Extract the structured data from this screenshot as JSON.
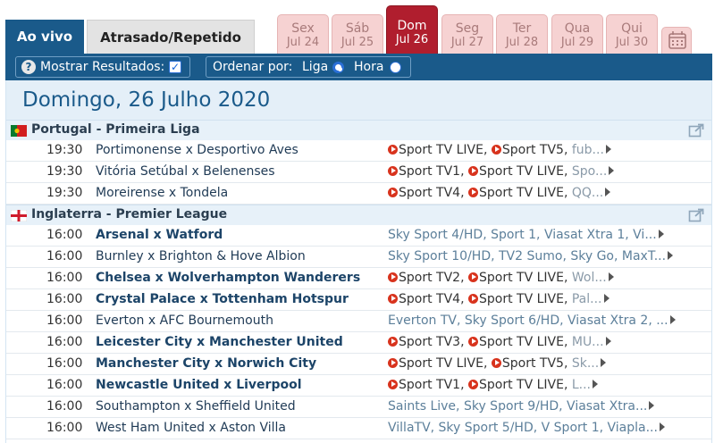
{
  "tabs": {
    "live": "Ao vivo",
    "delayed": "Atrasado/Repetido"
  },
  "days": [
    {
      "name": "Sex",
      "date": "Jul 24"
    },
    {
      "name": "Sáb",
      "date": "Jul 25"
    },
    {
      "name": "Dom",
      "date": "Jul 26"
    },
    {
      "name": "Seg",
      "date": "Jul 27"
    },
    {
      "name": "Ter",
      "date": "Jul 28"
    },
    {
      "name": "Qua",
      "date": "Jul 29"
    },
    {
      "name": "Qui",
      "date": "Jul 30"
    }
  ],
  "active_day": "Dom",
  "options": {
    "help": "?",
    "show_results": "Mostrar Resultados:",
    "order_by": "Ordenar por:",
    "order_league": "Liga",
    "order_time": "Hora"
  },
  "date_title": "Domingo, 26 Julho 2020",
  "leagues": [
    {
      "name": "Portugal - Primeira Liga",
      "matches": [
        {
          "time": "19:30",
          "teams": "Portimonense x Desportivo Aves",
          "bold": false,
          "live": [
            "Sport TV LIVE",
            "Sport TV5"
          ],
          "extra": "fub..."
        },
        {
          "time": "19:30",
          "teams": "Vitória Setúbal x Belenenses",
          "bold": false,
          "live": [
            "Sport TV1",
            "Sport TV LIVE"
          ],
          "extra": "Spo..."
        },
        {
          "time": "19:30",
          "teams": "Moreirense x Tondela",
          "bold": false,
          "live": [
            "Sport TV4",
            "Sport TV LIVE"
          ],
          "extra": "QQ..."
        }
      ]
    },
    {
      "name": "Inglaterra - Premier League",
      "matches": [
        {
          "time": "16:00",
          "teams": "Arsenal x Watford",
          "bold": true,
          "live": [],
          "extra": "Sky Sport 4/HD, Sport 1, Viasat Xtra 1, Vi..."
        },
        {
          "time": "16:00",
          "teams": "Burnley x Brighton & Hove Albion",
          "bold": false,
          "live": [],
          "extra": "Sky Sport 10/HD, TV2 Sumo, Sky Go, MaxT..."
        },
        {
          "time": "16:00",
          "teams": "Chelsea x Wolverhampton Wanderers",
          "bold": true,
          "live": [
            "Sport TV2",
            "Sport TV LIVE"
          ],
          "extra": "Wol..."
        },
        {
          "time": "16:00",
          "teams": "Crystal Palace x Tottenham Hotspur",
          "bold": true,
          "live": [
            "Sport TV4",
            "Sport TV LIVE"
          ],
          "extra": "Pal..."
        },
        {
          "time": "16:00",
          "teams": "Everton x AFC Bournemouth",
          "bold": false,
          "live": [],
          "extra": "Everton TV, Sky Sport 6/HD, Viasat Xtra 2, ..."
        },
        {
          "time": "16:00",
          "teams": "Leicester City x Manchester United",
          "bold": true,
          "live": [
            "Sport TV3",
            "Sport TV LIVE"
          ],
          "extra": "MU..."
        },
        {
          "time": "16:00",
          "teams": "Manchester City x Norwich City",
          "bold": true,
          "live": [
            "Sport TV LIVE",
            "Sport TV5"
          ],
          "extra": "Sk..."
        },
        {
          "time": "16:00",
          "teams": "Newcastle United x Liverpool",
          "bold": true,
          "live": [
            "Sport TV1",
            "Sport TV LIVE"
          ],
          "extra": "L..."
        },
        {
          "time": "16:00",
          "teams": "Southampton x Sheffield United",
          "bold": false,
          "live": [],
          "extra": "Saints Live, Sky Sport 9/HD, Viasat Xtra..."
        },
        {
          "time": "16:00",
          "teams": "West Ham United x Aston Villa",
          "bold": false,
          "live": [],
          "extra": "VillaTV, Sky Sport 5/HD, V Sport 1, Viapla..."
        }
      ]
    }
  ]
}
